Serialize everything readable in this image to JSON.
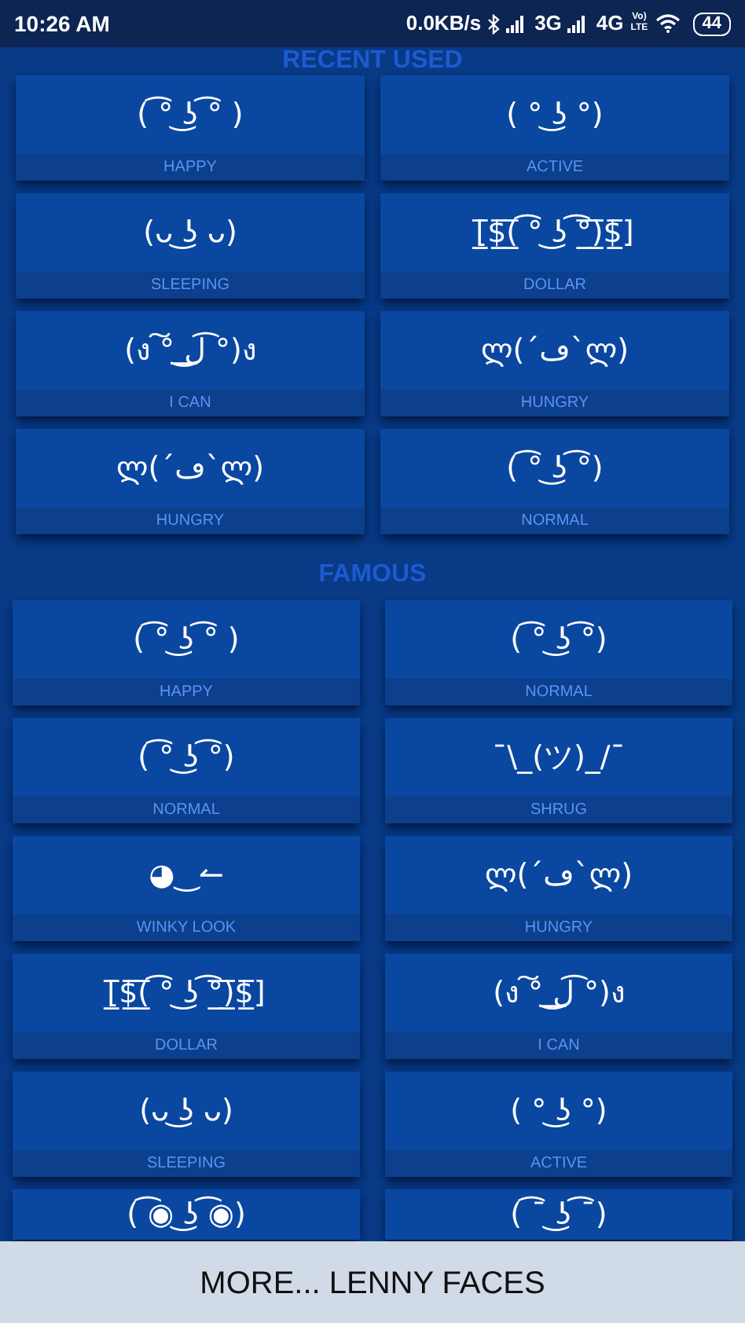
{
  "status_bar": {
    "time": "10:26 AM",
    "speed": "0.0KB/s",
    "network_1": "3G",
    "network_2": "4G",
    "volte": "Vo) LTE",
    "battery": "44"
  },
  "sections": [
    {
      "title": "RECENT USED",
      "items": [
        {
          "face": "( ͡° ͜ʖ ͡° )",
          "label": "HAPPY"
        },
        {
          "face": "( ° ͜ʖ °)",
          "label": "ACTIVE"
        },
        {
          "face": "(ᴗ ͜ʖ ᴗ)",
          "label": "SLEEPING"
        },
        {
          "face": "[̲̅$̲̅(̲̅ ͡° ͜ʖ ͡°̲̅)̲̅$̲̅]",
          "label": "DOLLAR"
        },
        {
          "face": "(ง ͠° ͟ل͜ ͡°)ง",
          "label": "I CAN"
        },
        {
          "face": "ლ(´ڡ`ლ)",
          "label": "HUNGRY"
        },
        {
          "face": "ლ(´ڡ`ლ)",
          "label": "HUNGRY"
        },
        {
          "face": "( ͡° ͜ʖ ͡°)",
          "label": "NORMAL"
        }
      ]
    },
    {
      "title": "FAMOUS",
      "items": [
        {
          "face": "( ͡° ͜ʖ ͡° )",
          "label": "HAPPY"
        },
        {
          "face": "( ͡° ͜ʖ ͡°)",
          "label": "NORMAL"
        },
        {
          "face": "( ͡° ͜ʖ ͡°)",
          "label": "NORMAL"
        },
        {
          "face": "¯\\_(ツ)_/¯",
          "label": "SHRUG"
        },
        {
          "face": "◕‿↼",
          "label": "WINKY LOOK"
        },
        {
          "face": "ლ(´ڡ`ლ)",
          "label": "HUNGRY"
        },
        {
          "face": "[̲̅$̲̅(̲̅ ͡° ͜ʖ ͡°̲̅)̲̅$̲̅]",
          "label": "DOLLAR"
        },
        {
          "face": "(ง ͠° ͟ل͜ ͡°)ง",
          "label": "I CAN"
        },
        {
          "face": "(ᴗ ͜ʖ ᴗ)",
          "label": "SLEEPING"
        },
        {
          "face": "( ° ͜ʖ °)",
          "label": "ACTIVE"
        },
        {
          "face": "( ͡◉ ͜ʖ ͡◉)"
        },
        {
          "face": "( ͡¯ ͜ʖ ͡¯)"
        }
      ]
    }
  ],
  "more_button": "MORE... LENNY FACES"
}
